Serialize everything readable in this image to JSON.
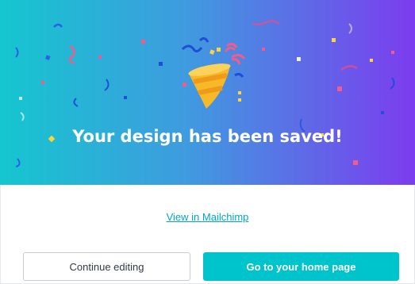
{
  "dialog": {
    "title": "Your design has been saved!",
    "link_text": "View in Mailchimp",
    "secondary_button": "Continue editing",
    "primary_button": "Go to your home page"
  },
  "icons": {
    "celebration": "party-popper-icon"
  },
  "colors": {
    "gradient_start": "#17c3cf",
    "gradient_end": "#7d3ff0",
    "primary_button": "#00c4cc",
    "link": "#00a7c4",
    "popper_yellow": "#f7b928",
    "popper_orange": "#f09a1a"
  }
}
